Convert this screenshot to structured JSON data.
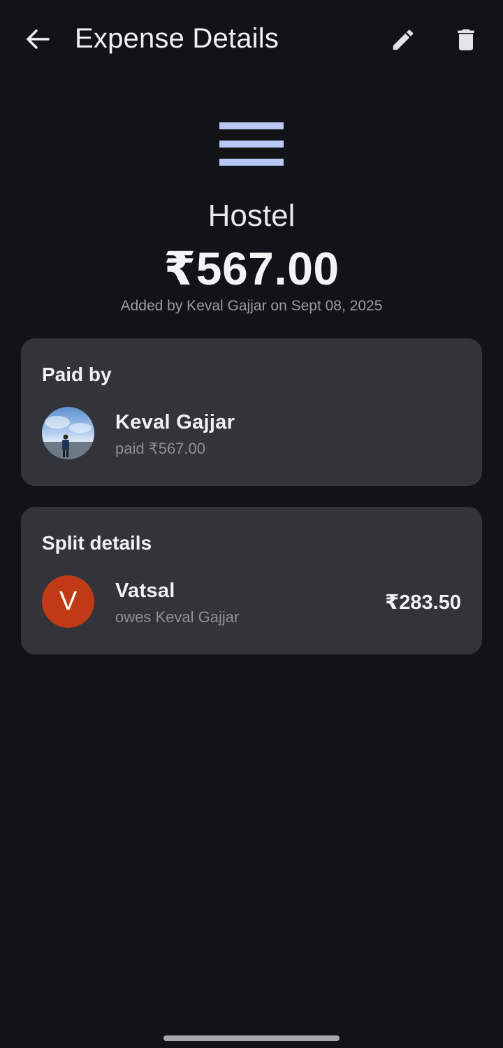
{
  "appbar": {
    "title": "Expense Details",
    "back_icon": "arrow-back-icon",
    "edit_icon": "pencil-icon",
    "delete_icon": "trash-icon"
  },
  "expense": {
    "category_icon": "menu-lines-icon",
    "name": "Hostel",
    "amount": "₹567.00",
    "added_by": "Added by Keval Gajjar on Sept 08, 2025"
  },
  "paid_by": {
    "title": "Paid by",
    "name": "Keval Gajjar",
    "subtitle": "paid ₹567.00"
  },
  "split": {
    "title": "Split details",
    "items": [
      {
        "initial": "V",
        "name": "Vatsal",
        "subtitle": "owes Keval Gajjar",
        "amount": "₹283.50"
      }
    ]
  },
  "colors": {
    "background": "#121319",
    "card": "#33343a",
    "accent_icon": "#b9c8f5",
    "avatar_v": "#c13a16"
  }
}
